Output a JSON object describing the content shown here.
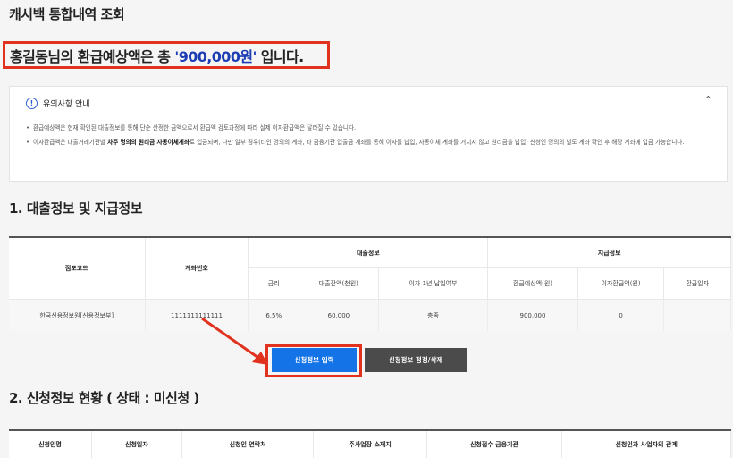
{
  "page": {
    "title": "캐시백 통합내역 조회"
  },
  "refund": {
    "prefix": "홍길동님의 환급예상액은 총",
    "amount": "'900,000원'",
    "suffix": "입니다."
  },
  "notice": {
    "title": "유의사항 안내",
    "items": [
      "환급예상액은 현재 확인된 대출정보를 통해 단순 산정한 금액으로서 환급액 검토과정에 따라 실제 이자환급액은 달라질 수 있습니다.",
      "이자환급액은 대출거래기관별",
      "차주 명의의 원리금 자동이체계좌",
      "로 입금되며, 다만 일부 경우(타인 명의의 계좌, 타 금융기관 입출금 계좌를 통해 이자를 납입, 자동이체 계좌를 거치지 않고 원리금을 납입) 신청인 명의의 별도 계좌 확인 후 해당 계좌에 입금 가능합니다."
    ]
  },
  "section1": {
    "title": "1. 대출정보 및 지급정보",
    "group_loan": "대출정보",
    "group_pay": "지급정보",
    "headers": [
      "점포코드",
      "계좌번호",
      "금리",
      "대출잔액(천원)",
      "이자 1년 납입여부",
      "환급예상액(원)",
      "이자환급액(원)",
      "환급일자"
    ],
    "row": [
      "한국신용정보원[신용정보부]",
      "1111111111111",
      "6.5%",
      "60,000",
      "충족",
      "900,000",
      "0",
      ""
    ]
  },
  "buttons": {
    "apply": "신청정보 입력",
    "edit": "신청정보 정정/삭제"
  },
  "section2": {
    "title": "2. 신청정보 현황 ( 상태 : 미신청 )",
    "headers": [
      "신청인명",
      "신청일자",
      "신청인 연락처",
      "주사업장 소재지",
      "신청접수 금융기관",
      "신청인과 사업자의 관계"
    ]
  },
  "colors": {
    "accent": "#1473e6",
    "highlight": "#e0321e",
    "amount": "#1d3db5"
  }
}
